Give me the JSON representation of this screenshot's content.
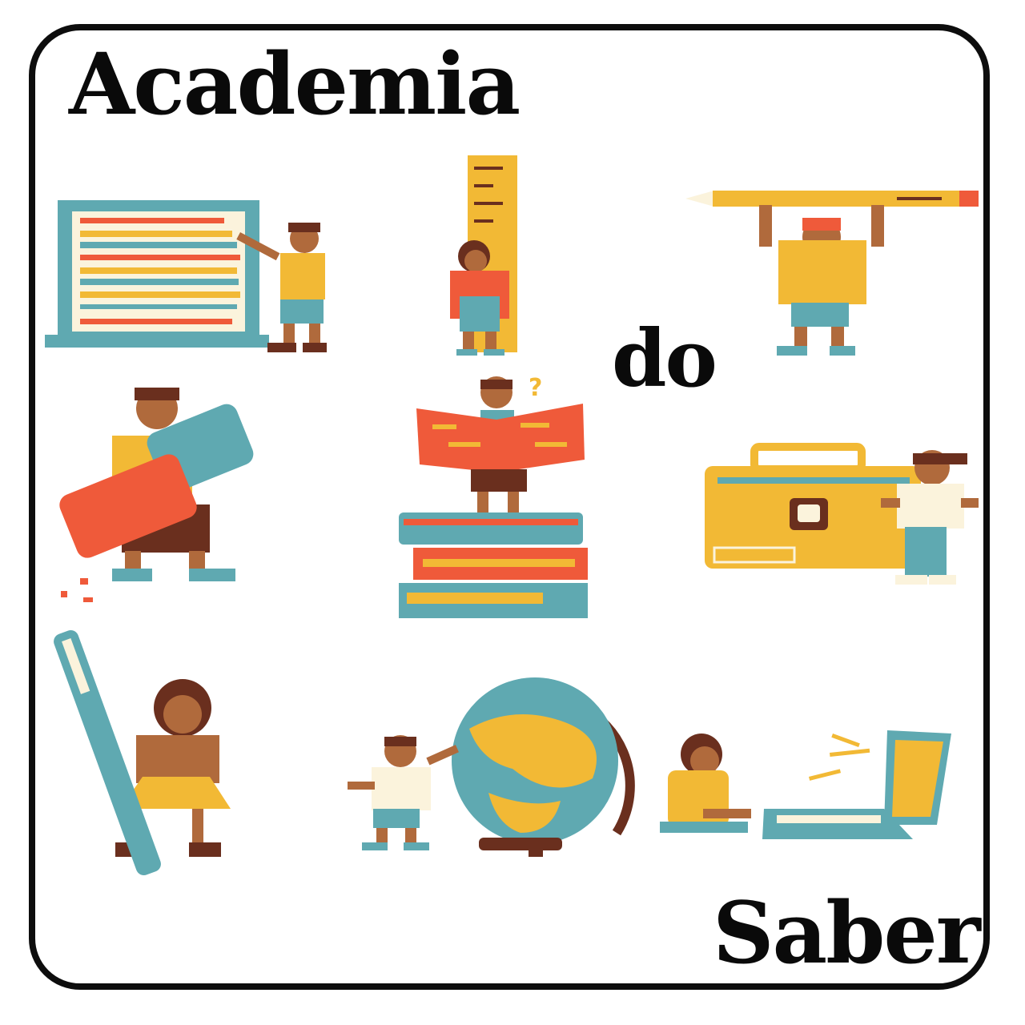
{
  "title": {
    "line1": "Academia",
    "line2": "do",
    "line3": "Saber"
  },
  "illustrations": [
    "abacus-icon",
    "ruler-icon",
    "pencil-icon",
    "eraser-icon",
    "book-stack-icon",
    "schoolbag-icon",
    "pen-icon",
    "globe-icon",
    "laptop-icon"
  ],
  "palette": {
    "yellow": "#f2b935",
    "teal": "#5fa9b1",
    "red": "#ef5a3a",
    "brown": "#6a2f1e",
    "cream": "#fbf3dc",
    "skin": "#b06a3c",
    "ink": "#0d0d0d"
  }
}
